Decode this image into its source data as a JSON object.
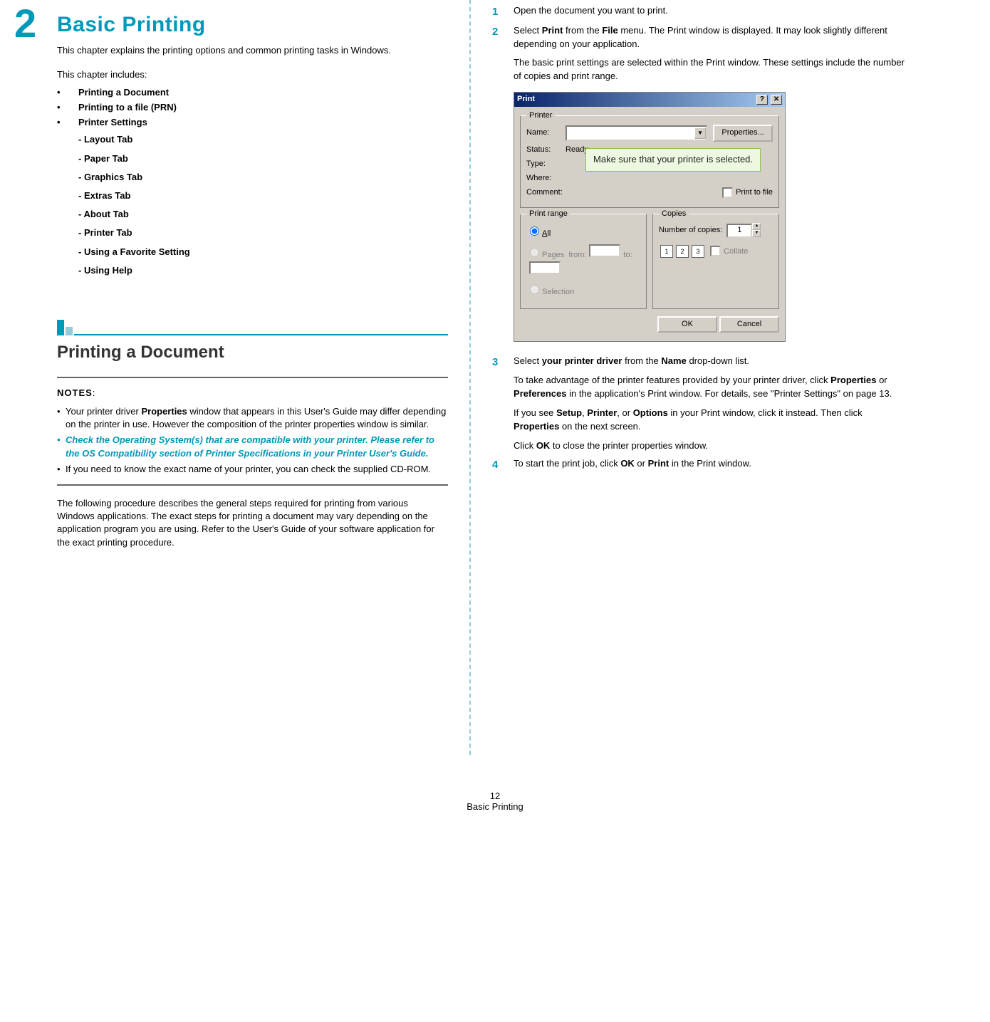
{
  "chapter_number": "2",
  "chapter_title": "Basic Printing",
  "intro": "This chapter explains the printing options and common printing tasks in Windows.",
  "includes_label": "This chapter includes:",
  "toc": {
    "items": [
      {
        "label": "Printing a Document"
      },
      {
        "label": "Printing to a file (PRN)"
      },
      {
        "label": "Printer Settings"
      }
    ],
    "subs": [
      {
        "label": "- Layout Tab"
      },
      {
        "label": "- Paper Tab"
      },
      {
        "label": "- Graphics Tab"
      },
      {
        "label": "- Extras Tab"
      },
      {
        "label": "- About Tab"
      },
      {
        "label": "- Printer Tab"
      },
      {
        "label": "- Using a Favorite Setting"
      },
      {
        "label": "- Using Help"
      }
    ]
  },
  "section_title": "Printing a Document",
  "notes": {
    "title": "NOTES",
    "colon": ":",
    "n1_pre": "Your printer driver ",
    "n1_b": "Properties",
    "n1_post": " window that appears in this User's Guide may differ depending on the printer in use. However the composition of the printer properties window is similar.",
    "n2": "Check the Operating System(s) that are compatible with your printer. Please refer to the OS Compatibility section of Printer Specifications in your Printer User's Guide.",
    "n3": "If you need to know the exact name of your printer, you can check the supplied CD-ROM."
  },
  "procedure_intro": "The following procedure describes the general steps required for printing from various Windows applications. The exact steps for printing a document may vary depending on the application program you are using. Refer to the User's Guide of your software application for the exact printing procedure.",
  "steps": {
    "s1": {
      "num": "1",
      "text": "Open the document you want to print."
    },
    "s2": {
      "num": "2",
      "pre": "Select ",
      "b1": "Print",
      "mid1": " from the ",
      "b2": "File",
      "post": " menu. The Print window is displayed. It may look slightly different depending on your application.",
      "sub": "The basic print settings are selected within the Print window. These settings include the number of copies and print range."
    },
    "s3": {
      "num": "3",
      "pre": "Select ",
      "b1": "your printer driver",
      "mid1": " from the ",
      "b2": "Name",
      "post": " drop-down list.",
      "sub1_pre": "To take advantage of the printer features provided by your printer driver, click ",
      "sub1_b1": "Properties",
      "sub1_mid": " or ",
      "sub1_b2": "Preferences",
      "sub1_post": " in the application's Print window. For details, see \"Printer Settings\" on page 13.",
      "sub2_pre": "If you see ",
      "sub2_b1": "Setup",
      "sub2_c1": ", ",
      "sub2_b2": "Printer",
      "sub2_c2": ", or ",
      "sub2_b3": "Options",
      "sub2_mid": " in your Print window, click it instead. Then click ",
      "sub2_b4": "Properties",
      "sub2_post": " on the next screen.",
      "sub3_pre": "Click ",
      "sub3_b": "OK",
      "sub3_post": " to close the printer properties window."
    },
    "s4": {
      "num": "4",
      "pre": "To start the print job, click ",
      "b1": "OK",
      "mid": " or ",
      "b2": "Print",
      "post": " in the Print window."
    }
  },
  "dialog": {
    "title": "Print",
    "help_btn": "?",
    "close_btn": "✕",
    "printer_group": "Printer",
    "name_label": "Name:",
    "status_label": "Status:",
    "status_value": "Ready",
    "type_label": "Type:",
    "where_label": "Where:",
    "comment_label": "Comment:",
    "properties_btn": "Properties...",
    "print_to_file": "Print to file",
    "range_group": "Print range",
    "all": "All",
    "pages": "Pages",
    "from": "from:",
    "to": "to:",
    "selection": "Selection",
    "copies_group": "Copies",
    "num_copies": "Number of copies:",
    "copies_value": "1",
    "collate": "Collate",
    "ok": "OK",
    "cancel": "Cancel",
    "callout": "Make sure that your printer is selected.",
    "c1": "1",
    "c2": "2",
    "c3": "3"
  },
  "footer": {
    "page": "12",
    "title": "Basic Printing"
  }
}
